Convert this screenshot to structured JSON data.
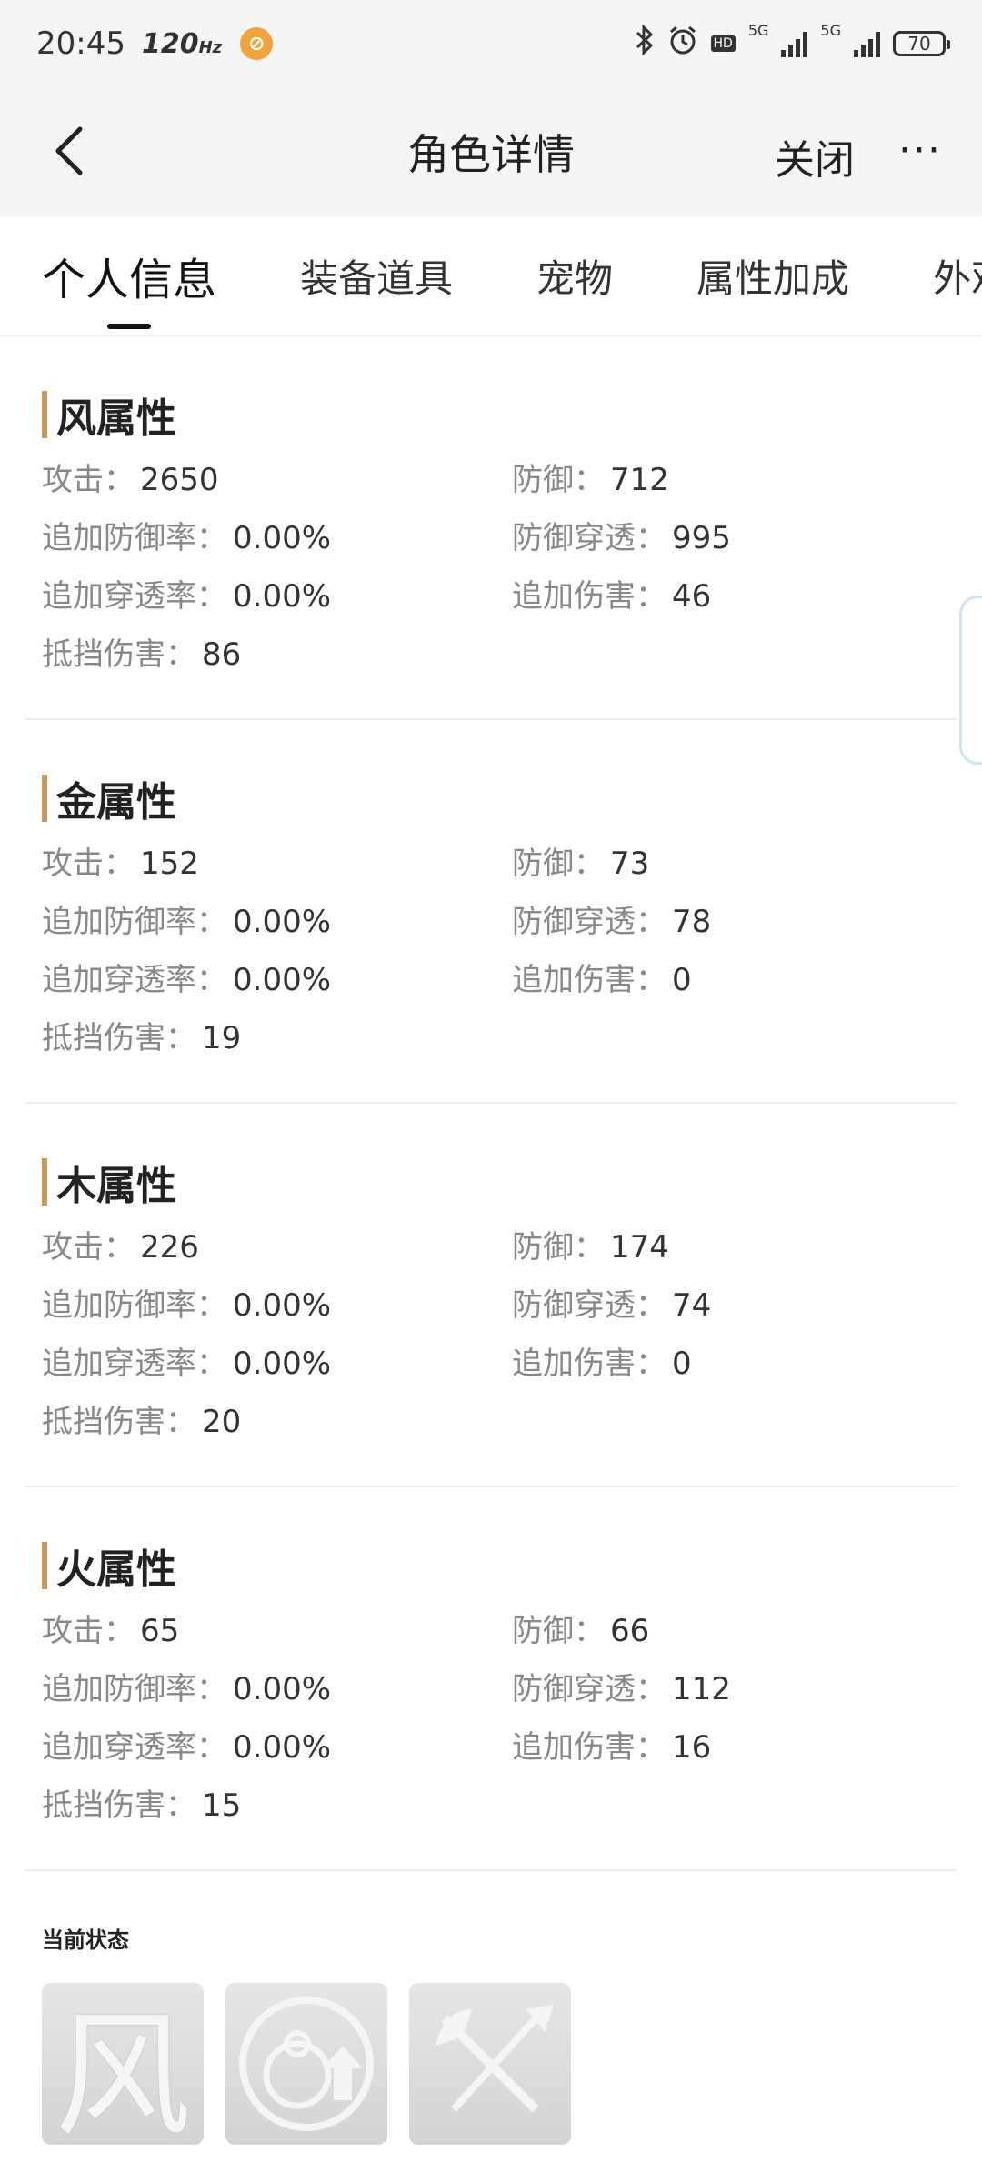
{
  "status_bar": {
    "time": "20:45",
    "refresh": "120",
    "refresh_unit": "Hz",
    "battery": "70",
    "net_1": "5G",
    "net_2": "5G"
  },
  "navbar": {
    "title": "角色详情",
    "close_label": "关闭",
    "more_label": "···"
  },
  "tabs": [
    "个人信息",
    "装备道具",
    "宠物",
    "属性加成",
    "外观"
  ],
  "active_tab": 0,
  "sections": [
    {
      "title": "风属性",
      "stats": [
        {
          "label": "攻击：",
          "value": "2650"
        },
        {
          "label": "防御：",
          "value": "712"
        },
        {
          "label": "追加防御率：",
          "value": "0.00%"
        },
        {
          "label": "防御穿透：",
          "value": "995"
        },
        {
          "label": "追加穿透率：",
          "value": "0.00%"
        },
        {
          "label": "追加伤害：",
          "value": "46"
        },
        {
          "label": "抵挡伤害：",
          "value": "86"
        }
      ]
    },
    {
      "title": "金属性",
      "stats": [
        {
          "label": "攻击：",
          "value": "152"
        },
        {
          "label": "防御：",
          "value": "73"
        },
        {
          "label": "追加防御率：",
          "value": "0.00%"
        },
        {
          "label": "防御穿透：",
          "value": "78"
        },
        {
          "label": "追加穿透率：",
          "value": "0.00%"
        },
        {
          "label": "追加伤害：",
          "value": "0"
        },
        {
          "label": "抵挡伤害：",
          "value": "19"
        }
      ]
    },
    {
      "title": "木属性",
      "stats": [
        {
          "label": "攻击：",
          "value": "226"
        },
        {
          "label": "防御：",
          "value": "174"
        },
        {
          "label": "追加防御率：",
          "value": "0.00%"
        },
        {
          "label": "防御穿透：",
          "value": "74"
        },
        {
          "label": "追加穿透率：",
          "value": "0.00%"
        },
        {
          "label": "追加伤害：",
          "value": "0"
        },
        {
          "label": "抵挡伤害：",
          "value": "20"
        }
      ]
    },
    {
      "title": "火属性",
      "stats": [
        {
          "label": "攻击：",
          "value": "65"
        },
        {
          "label": "防御：",
          "value": "66"
        },
        {
          "label": "追加防御率：",
          "value": "0.00%"
        },
        {
          "label": "防御穿透：",
          "value": "112"
        },
        {
          "label": "追加穿透率：",
          "value": "0.00%"
        },
        {
          "label": "追加伤害：",
          "value": "16"
        },
        {
          "label": "抵挡伤害：",
          "value": "15"
        }
      ]
    }
  ],
  "current_status": {
    "title": "当前状态",
    "icons": [
      {
        "name": "wind-buff-icon",
        "glyph": "风"
      },
      {
        "name": "gourd-upgrade-icon"
      },
      {
        "name": "crossed-weapons-icon"
      }
    ]
  }
}
